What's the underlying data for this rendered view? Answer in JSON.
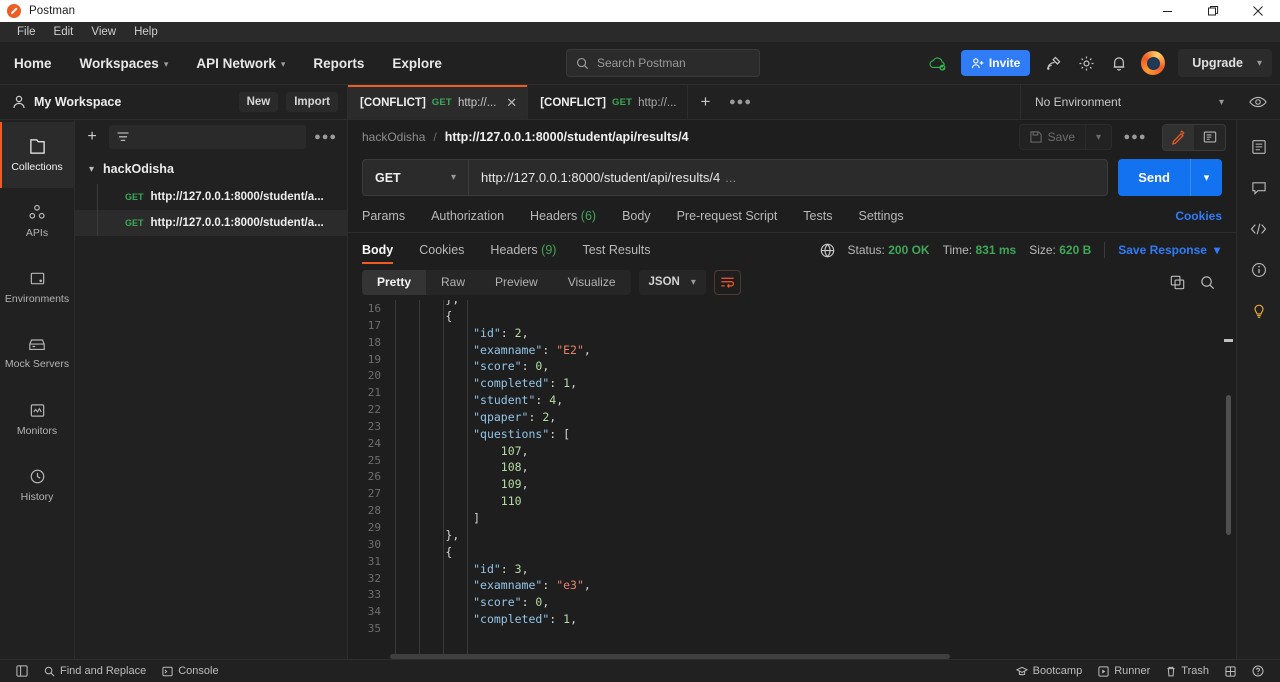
{
  "window": {
    "title": "Postman",
    "controls": {
      "minimize": "minimize-icon",
      "maximize": "maximize-icon",
      "close": "close-icon"
    }
  },
  "menubar": {
    "items": [
      "File",
      "Edit",
      "View",
      "Help"
    ]
  },
  "header": {
    "nav": [
      {
        "label": "Home",
        "caret": false
      },
      {
        "label": "Workspaces",
        "caret": true
      },
      {
        "label": "API Network",
        "caret": true
      },
      {
        "label": "Reports",
        "caret": false
      },
      {
        "label": "Explore",
        "caret": false
      }
    ],
    "search": {
      "placeholder": "Search Postman",
      "icon": "search-icon"
    },
    "sync_icon": "cloud-sync-icon",
    "invite_label": "Invite",
    "icons": [
      "satellite-icon",
      "gear-icon",
      "bell-icon"
    ],
    "upgrade_label": "Upgrade"
  },
  "workspace": {
    "name": "My Workspace",
    "new_label": "New",
    "import_label": "Import",
    "environment": {
      "selected": "No Environment",
      "eye_icon": "eye-icon"
    }
  },
  "tabs": [
    {
      "title": "[CONFLICT]",
      "method": "GET",
      "url": "http://...",
      "active": true
    },
    {
      "title": "[CONFLICT]",
      "method": "GET",
      "url": "http://...",
      "active": false
    }
  ],
  "sidebar": {
    "items": [
      {
        "label": "Collections",
        "icon": "collections-icon",
        "active": true
      },
      {
        "label": "APIs",
        "icon": "apis-icon",
        "active": false
      },
      {
        "label": "Environments",
        "icon": "environments-icon",
        "active": false
      },
      {
        "label": "Mock Servers",
        "icon": "mock-servers-icon",
        "active": false
      },
      {
        "label": "Monitors",
        "icon": "monitors-icon",
        "active": false
      },
      {
        "label": "History",
        "icon": "history-icon",
        "active": false
      }
    ]
  },
  "collections": {
    "folder": "hackOdisha",
    "requests": [
      {
        "method": "GET",
        "url": "http://127.0.0.1:8000/student/a...",
        "selected": false
      },
      {
        "method": "GET",
        "url": "http://127.0.0.1:8000/student/a...",
        "selected": true
      }
    ]
  },
  "request": {
    "breadcrumb_collection": "hackOdisha",
    "breadcrumb_separator": "/",
    "name": "http://127.0.0.1:8000/student/api/results/4",
    "save_label": "Save",
    "method": "GET",
    "url": "http://127.0.0.1:8000/student/api/results/4",
    "url_suffix": "...",
    "send_label": "Send",
    "tabs": [
      {
        "label": "Params",
        "count": ""
      },
      {
        "label": "Authorization",
        "count": ""
      },
      {
        "label": "Headers",
        "count": "(6)"
      },
      {
        "label": "Body",
        "count": ""
      },
      {
        "label": "Pre-request Script",
        "count": ""
      },
      {
        "label": "Tests",
        "count": ""
      },
      {
        "label": "Settings",
        "count": ""
      }
    ],
    "cookies_link": "Cookies"
  },
  "response": {
    "tabs": [
      {
        "label": "Body",
        "count": "",
        "active": true
      },
      {
        "label": "Cookies",
        "count": "",
        "active": false
      },
      {
        "label": "Headers",
        "count": "(9)",
        "active": false
      },
      {
        "label": "Test Results",
        "count": "",
        "active": false
      }
    ],
    "status_label": "Status:",
    "status_value": "200 OK",
    "time_label": "Time:",
    "time_value": "831 ms",
    "size_label": "Size:",
    "size_value": "620 B",
    "save_response_label": "Save Response",
    "view_modes": [
      {
        "label": "Pretty",
        "active": true
      },
      {
        "label": "Raw",
        "active": false
      },
      {
        "label": "Preview",
        "active": false
      },
      {
        "label": "Visualize",
        "active": false
      }
    ],
    "format": "JSON",
    "wrap_icon": "word-wrap-icon",
    "copy_icon": "copy-icon",
    "search_icon": "search-icon"
  },
  "code": {
    "first_line_number": 16,
    "lines": [
      {
        "num": 16,
        "indent": 2,
        "tokens": [
          {
            "t": "p",
            "v": "},"
          }
        ]
      },
      {
        "num": 17,
        "indent": 2,
        "tokens": [
          {
            "t": "p",
            "v": "{"
          }
        ]
      },
      {
        "num": 18,
        "indent": 3,
        "tokens": [
          {
            "t": "k",
            "v": "\"id\""
          },
          {
            "t": "p",
            "v": ": "
          },
          {
            "t": "n",
            "v": "2"
          },
          {
            "t": "p",
            "v": ","
          }
        ]
      },
      {
        "num": 19,
        "indent": 3,
        "tokens": [
          {
            "t": "k",
            "v": "\"examname\""
          },
          {
            "t": "p",
            "v": ": "
          },
          {
            "t": "s",
            "v": "\"E2\""
          },
          {
            "t": "p",
            "v": ","
          }
        ]
      },
      {
        "num": 20,
        "indent": 3,
        "tokens": [
          {
            "t": "k",
            "v": "\"score\""
          },
          {
            "t": "p",
            "v": ": "
          },
          {
            "t": "n",
            "v": "0"
          },
          {
            "t": "p",
            "v": ","
          }
        ]
      },
      {
        "num": 21,
        "indent": 3,
        "tokens": [
          {
            "t": "k",
            "v": "\"completed\""
          },
          {
            "t": "p",
            "v": ": "
          },
          {
            "t": "n",
            "v": "1"
          },
          {
            "t": "p",
            "v": ","
          }
        ]
      },
      {
        "num": 22,
        "indent": 3,
        "tokens": [
          {
            "t": "k",
            "v": "\"student\""
          },
          {
            "t": "p",
            "v": ": "
          },
          {
            "t": "n",
            "v": "4"
          },
          {
            "t": "p",
            "v": ","
          }
        ]
      },
      {
        "num": 23,
        "indent": 3,
        "tokens": [
          {
            "t": "k",
            "v": "\"qpaper\""
          },
          {
            "t": "p",
            "v": ": "
          },
          {
            "t": "n",
            "v": "2"
          },
          {
            "t": "p",
            "v": ","
          }
        ]
      },
      {
        "num": 24,
        "indent": 3,
        "tokens": [
          {
            "t": "k",
            "v": "\"questions\""
          },
          {
            "t": "p",
            "v": ": ["
          }
        ]
      },
      {
        "num": 25,
        "indent": 4,
        "tokens": [
          {
            "t": "n",
            "v": "107"
          },
          {
            "t": "p",
            "v": ","
          }
        ]
      },
      {
        "num": 26,
        "indent": 4,
        "tokens": [
          {
            "t": "n",
            "v": "108"
          },
          {
            "t": "p",
            "v": ","
          }
        ]
      },
      {
        "num": 27,
        "indent": 4,
        "tokens": [
          {
            "t": "n",
            "v": "109"
          },
          {
            "t": "p",
            "v": ","
          }
        ]
      },
      {
        "num": 28,
        "indent": 4,
        "tokens": [
          {
            "t": "n",
            "v": "110"
          }
        ]
      },
      {
        "num": 29,
        "indent": 3,
        "tokens": [
          {
            "t": "p",
            "v": "]"
          }
        ]
      },
      {
        "num": 30,
        "indent": 2,
        "tokens": [
          {
            "t": "p",
            "v": "},"
          }
        ]
      },
      {
        "num": 31,
        "indent": 2,
        "tokens": [
          {
            "t": "p",
            "v": "{"
          }
        ]
      },
      {
        "num": 32,
        "indent": 3,
        "tokens": [
          {
            "t": "k",
            "v": "\"id\""
          },
          {
            "t": "p",
            "v": ": "
          },
          {
            "t": "n",
            "v": "3"
          },
          {
            "t": "p",
            "v": ","
          }
        ]
      },
      {
        "num": 33,
        "indent": 3,
        "tokens": [
          {
            "t": "k",
            "v": "\"examname\""
          },
          {
            "t": "p",
            "v": ": "
          },
          {
            "t": "s",
            "v": "\"e3\""
          },
          {
            "t": "p",
            "v": ","
          }
        ]
      },
      {
        "num": 34,
        "indent": 3,
        "tokens": [
          {
            "t": "k",
            "v": "\"score\""
          },
          {
            "t": "p",
            "v": ": "
          },
          {
            "t": "n",
            "v": "0"
          },
          {
            "t": "p",
            "v": ","
          }
        ]
      },
      {
        "num": 35,
        "indent": 3,
        "tokens": [
          {
            "t": "k",
            "v": "\"completed\""
          },
          {
            "t": "p",
            "v": ": "
          },
          {
            "t": "n",
            "v": "1"
          },
          {
            "t": "p",
            "v": ","
          }
        ]
      }
    ]
  },
  "right_rail": {
    "items": [
      "documentation-icon",
      "comments-icon",
      "code-snippet-icon",
      "info-icon",
      "bulb-icon"
    ]
  },
  "statusbar": {
    "left": [
      {
        "label": "",
        "icon": "sidebar-toggle-icon"
      },
      {
        "label": "Find and Replace",
        "icon": "search-icon"
      },
      {
        "label": "Console",
        "icon": "console-icon"
      }
    ],
    "right": [
      {
        "label": "Bootcamp",
        "icon": "bootcamp-icon"
      },
      {
        "label": "Runner",
        "icon": "runner-icon"
      },
      {
        "label": "Trash",
        "icon": "trash-icon"
      },
      {
        "label": "",
        "icon": "layout-icon"
      },
      {
        "label": "",
        "icon": "help-icon"
      }
    ]
  },
  "colors": {
    "accent_orange": "#ef5b25",
    "blue": "#1272ef",
    "green": "#3ea757",
    "bg": "#1e1e1e",
    "panel": "#212121"
  }
}
